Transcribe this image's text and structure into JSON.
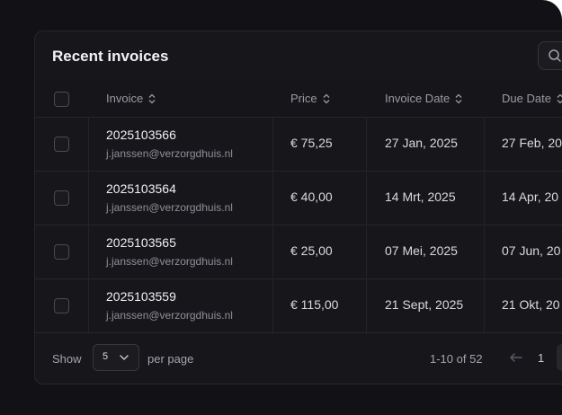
{
  "card": {
    "title": "Recent invoices"
  },
  "table": {
    "headers": {
      "invoice": "Invoice",
      "price": "Price",
      "invoice_date": "Invoice Date",
      "due_date": "Due Date"
    },
    "rows": [
      {
        "invoice": "2025103566",
        "email": "j.janssen@verzorgdhuis.nl",
        "price": "€ 75,25",
        "invoice_date": "27 Jan, 2025",
        "due_date": "27 Feb, 20"
      },
      {
        "invoice": "2025103564",
        "email": "j.janssen@verzorgdhuis.nl",
        "price": "€ 40,00",
        "invoice_date": "14 Mrt, 2025",
        "due_date": "14 Apr, 20"
      },
      {
        "invoice": "2025103565",
        "email": "j.janssen@verzorgdhuis.nl",
        "price": "€ 25,00",
        "invoice_date": "07 Mei, 2025",
        "due_date": "07 Jun, 20"
      },
      {
        "invoice": "2025103559",
        "email": "j.janssen@verzorgdhuis.nl",
        "price": "€ 115,00",
        "invoice_date": "21 Sept, 2025",
        "due_date": "21 Okt, 20"
      }
    ]
  },
  "footer": {
    "show_label": "Show",
    "per_page_value": "5",
    "per_page_label": "per page",
    "range": "1-10 of 52",
    "current_page": "1"
  },
  "icons": {
    "search": "search-icon",
    "sort": "sort-icon",
    "chevron": "chevron-down-icon",
    "prev": "arrow-left-icon"
  },
  "colors": {
    "background": "#121216",
    "card": "#17171b",
    "text_primary": "#f1f1f4",
    "text_secondary": "#8e8e97"
  }
}
